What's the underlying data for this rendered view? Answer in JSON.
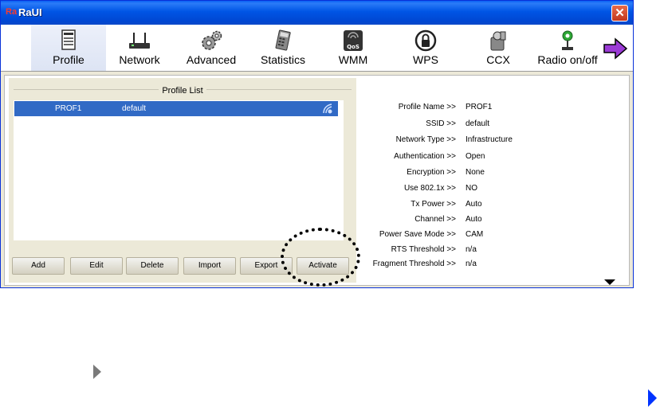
{
  "window": {
    "title": "RaUI",
    "close_label": "✕",
    "logo_text": "Ra"
  },
  "toolbar": {
    "items": [
      {
        "label": "Profile",
        "icon": "profile-document-icon"
      },
      {
        "label": "Network",
        "icon": "router-icon"
      },
      {
        "label": "Advanced",
        "icon": "gears-icon"
      },
      {
        "label": "Statistics",
        "icon": "calculator-icon"
      },
      {
        "label": "WMM",
        "icon": "qos-icon"
      },
      {
        "label": "WPS",
        "icon": "wps-lock-icon"
      },
      {
        "label": "CCX",
        "icon": "ccx-icon"
      },
      {
        "label": "Radio on/off",
        "icon": "radio-antenna-icon"
      }
    ],
    "next_icon": "next-arrow-icon"
  },
  "profile_list": {
    "title": "Profile List",
    "rows": [
      {
        "name": "PROF1",
        "ssid": "default",
        "icon": "connected-status-icon"
      }
    ]
  },
  "buttons": {
    "add": "Add",
    "edit": "Edit",
    "delete": "Delete",
    "import": "Import",
    "export": "Export",
    "activate": "Activate"
  },
  "details": [
    {
      "key": "Profile Name >>",
      "value": "PROF1"
    },
    {
      "key": "SSID >>",
      "value": "default"
    },
    {
      "key": "Network Type >>",
      "value": "Infrastructure"
    },
    {
      "key": "Authentication >>",
      "value": "Open"
    },
    {
      "key": "Encryption >>",
      "value": "None"
    },
    {
      "key": "Use 802.1x >>",
      "value": "NO"
    },
    {
      "key": "Tx Power >>",
      "value": "Auto"
    },
    {
      "key": "Channel >>",
      "value": "Auto"
    },
    {
      "key": "Power Save Mode >>",
      "value": "CAM"
    },
    {
      "key": "RTS Threshold >>",
      "value": "n/a"
    },
    {
      "key": "Fragment Threshold >>",
      "value": "n/a"
    }
  ],
  "colors": {
    "title_bar": "#0055E5",
    "selection": "#316AC5",
    "highlight_circle": "#000000",
    "bullet_blue": "#0033FF",
    "bullet_grey": "#7A7A7A"
  }
}
